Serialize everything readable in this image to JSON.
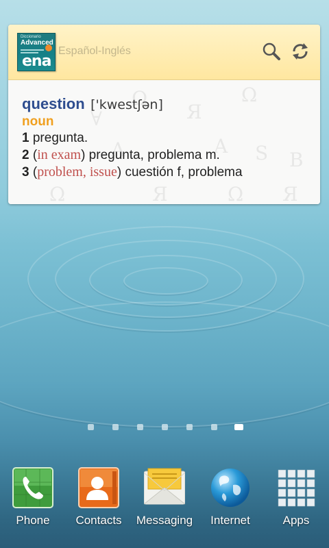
{
  "widget": {
    "title": "Español-Inglés",
    "book_cover": {
      "line1": "Diccionario",
      "line2": "Advanced",
      "abbr": "ena"
    },
    "entry": {
      "headword": "question",
      "pronunciation": "['kwestʃən]",
      "part_of_speech": "noun",
      "senses": [
        {
          "num": "1",
          "context": "",
          "text": "pregunta."
        },
        {
          "num": "2",
          "context": "in exam",
          "text": "pregunta, problema m."
        },
        {
          "num": "3",
          "context": "problem, issue",
          "text": "cuestión f, problema"
        }
      ]
    }
  },
  "home": {
    "pages": 7,
    "active_page": 7,
    "dock": [
      {
        "label": "Phone",
        "icon": "phone-icon"
      },
      {
        "label": "Contacts",
        "icon": "contacts-icon"
      },
      {
        "label": "Messaging",
        "icon": "messaging-icon"
      },
      {
        "label": "Internet",
        "icon": "globe-icon"
      },
      {
        "label": "Apps",
        "icon": "apps-grid-icon"
      }
    ]
  },
  "colors": {
    "headword": "#2e4d8f",
    "part_of_speech": "#f0a020",
    "context": "#c0504d",
    "header_bg": "#ffe7a0"
  }
}
